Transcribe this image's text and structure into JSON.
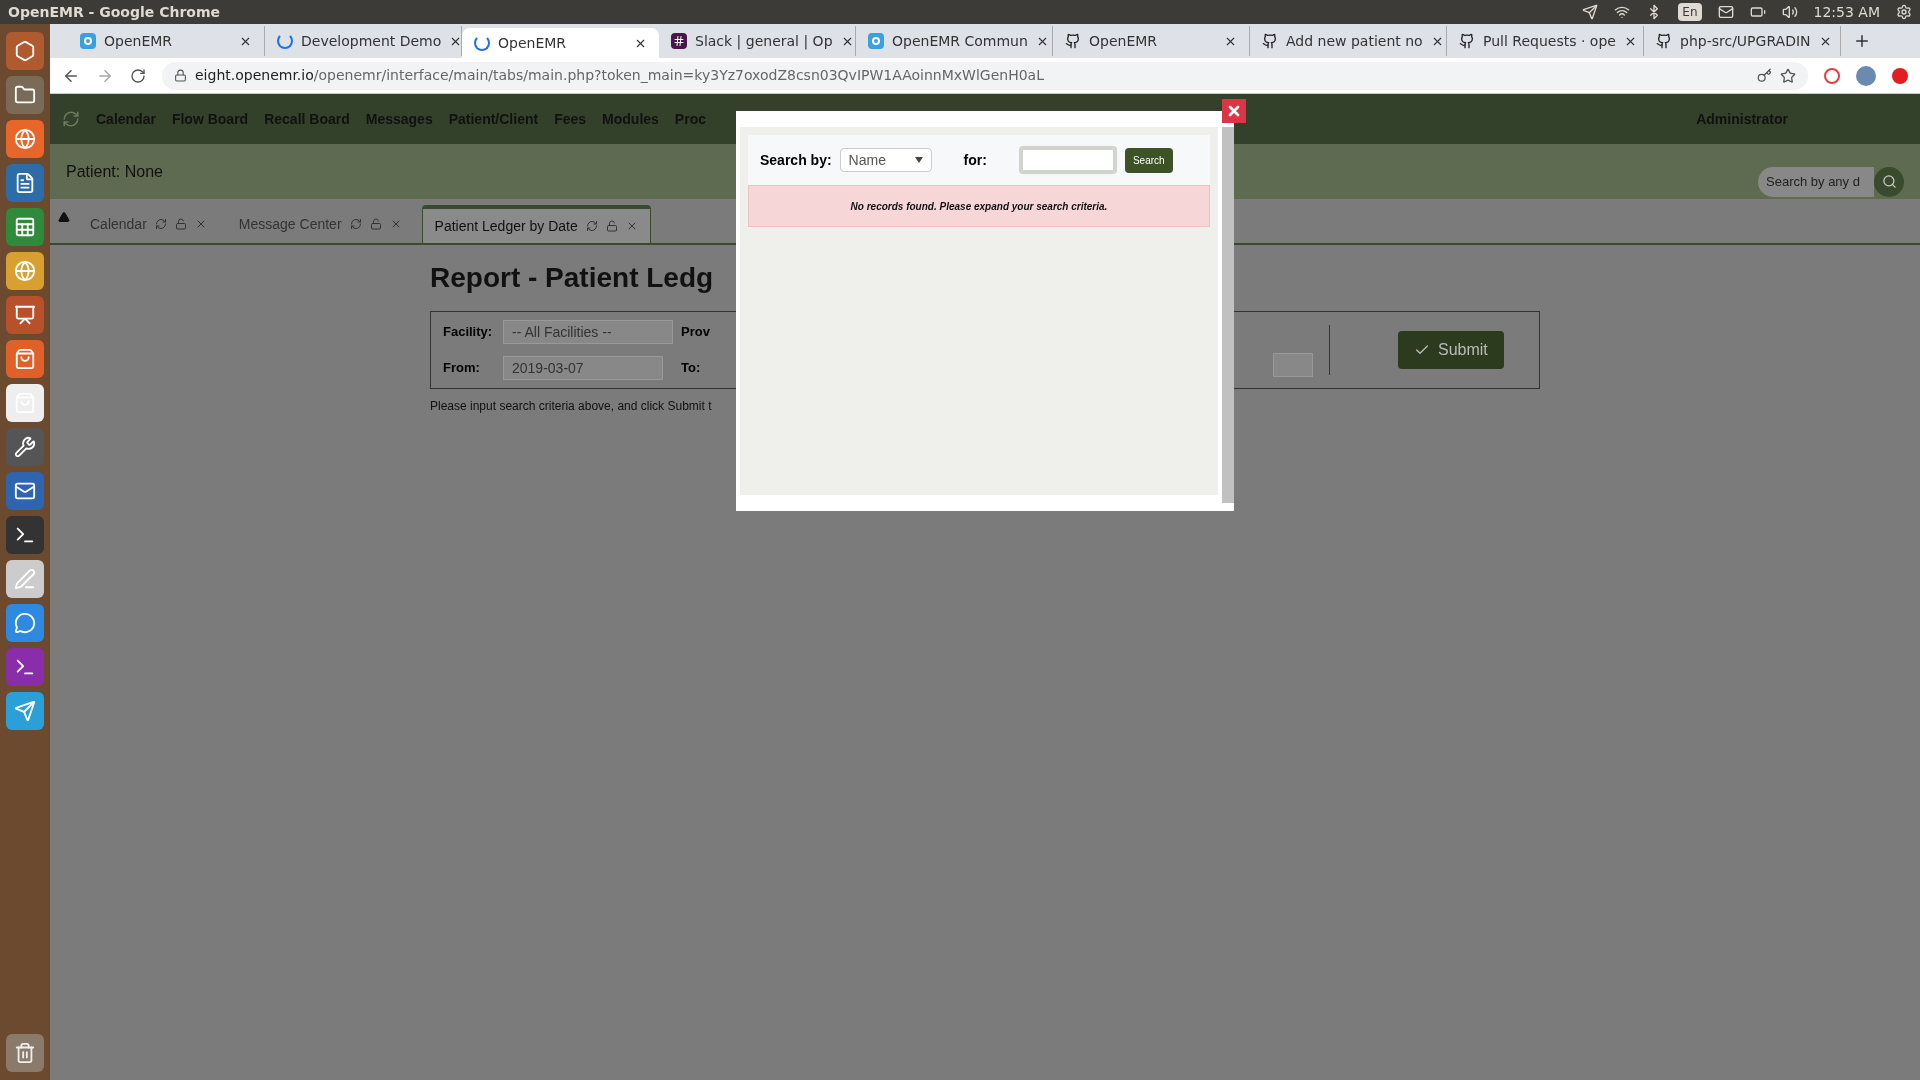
{
  "os_bar": {
    "title": "OpenEMR - Google Chrome",
    "language": "En",
    "time": "12:53 AM"
  },
  "browser": {
    "tabs": [
      {
        "title": "OpenEMR",
        "kind": "openemr",
        "selected": false
      },
      {
        "title": "Development Demo",
        "kind": "loading",
        "selected": false
      },
      {
        "title": "OpenEMR",
        "kind": "loading",
        "selected": true
      },
      {
        "title": "Slack | general | Op",
        "kind": "slack",
        "selected": false
      },
      {
        "title": "OpenEMR Commun",
        "kind": "openemr",
        "selected": false
      },
      {
        "title": "OpenEMR",
        "kind": "github",
        "selected": false
      },
      {
        "title": "Add new patient no",
        "kind": "github",
        "selected": false
      },
      {
        "title": "Pull Requests · ope",
        "kind": "github",
        "selected": false
      },
      {
        "title": "php-src/UPGRADIN",
        "kind": "github",
        "selected": false
      }
    ],
    "address": {
      "domain": "eight.openemr.io",
      "path": "/openemr/interface/main/tabs/main.php?token_main=ky3Yz7oxodZ8csn03QvIPW1AAoinnMxWlGenH0aL"
    }
  },
  "app": {
    "nav": {
      "items": [
        "Calendar",
        "Flow Board",
        "Recall Board",
        "Messages",
        "Patient/Client",
        "Fees",
        "Modules",
        "Proc"
      ],
      "user": "Administrator"
    },
    "patient": "Patient: None",
    "search": {
      "placeholder": "Search by any d"
    },
    "tabs": [
      {
        "label": "Calendar",
        "selected": false
      },
      {
        "label": "Message Center",
        "selected": false
      },
      {
        "label": "Patient Ledger by Date",
        "selected": true
      }
    ],
    "report": {
      "title": "Report - Patient Ledg",
      "facility_label": "Facility:",
      "facility_value": "-- All Facilities --",
      "provider_label": "Prov",
      "from_label": "From:",
      "from_value": "2019-03-07",
      "to_label": "To:",
      "submit": "Submit",
      "hint": "Please input search criteria above, and click Submit t"
    }
  },
  "dialog": {
    "search_by_label": "Search by:",
    "search_by_value": "Name",
    "for_label": "for:",
    "search_button": "Search",
    "message": "No records found. Please expand your search criteria."
  }
}
